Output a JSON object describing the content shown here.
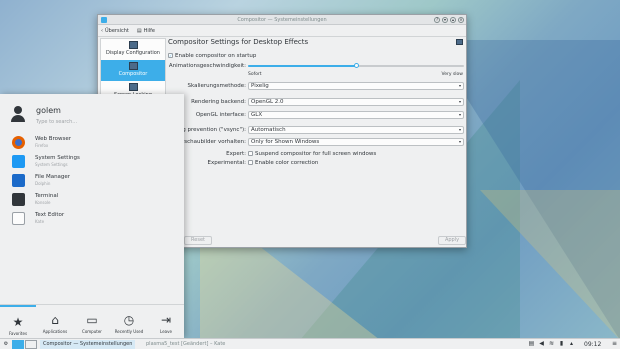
{
  "window": {
    "title": "Compositor — Systemeinstellungen",
    "back_label": "Übersicht",
    "help_label": "Hilfe",
    "sidebar": [
      {
        "label": "Display Configuration",
        "active": false
      },
      {
        "label": "Compositor",
        "active": true
      },
      {
        "label": "Screen Locking",
        "active": false
      }
    ],
    "heading": "Compositor Settings for Desktop Effects",
    "enable_label": "Enable compositor on startup",
    "animation_label": "Animationsgeschwindigkeit:",
    "animation_value": 0.5,
    "animation_min": "Sofort",
    "animation_max": "Very slow",
    "scaling_label": "Skalierungsmethode:",
    "scaling_value": "Pixelig",
    "backend_label": "Rendering backend:",
    "backend_value": "OpenGL 2.0",
    "interface_label": "OpenGL interface:",
    "interface_value": "GLX",
    "tearing_label": "Tearing prevention (\"vsync\"):",
    "tearing_value": "Automatisch",
    "thumb_label": "Vorschaubilder vorhalten:",
    "thumb_value": "Only for Shown Windows",
    "expert_label": "Expert:",
    "expert_option": "Suspend compositor for full screen windows",
    "experimental_label": "Experimental:",
    "experimental_option": "Enable color correction",
    "reset_label": "Reset",
    "apply_label": "Apply"
  },
  "launcher": {
    "user": "golem",
    "search_placeholder": "Type to search...",
    "apps": [
      {
        "name": "Web Browser",
        "desc": "Firefox",
        "color": "#e66000"
      },
      {
        "name": "System Settings",
        "desc": "System Settings",
        "color": "#1d99f3"
      },
      {
        "name": "File Manager",
        "desc": "Dolphin",
        "color": "#1b6ac9"
      },
      {
        "name": "Terminal",
        "desc": "Konsole",
        "color": "#31363b"
      },
      {
        "name": "Text Editor",
        "desc": "Kate",
        "color": "#fcfcfc"
      }
    ],
    "tabs": [
      {
        "label": "Favorites",
        "icon": "★"
      },
      {
        "label": "Applications",
        "icon": "⌂"
      },
      {
        "label": "Computer",
        "icon": "▭"
      },
      {
        "label": "Recently Used",
        "icon": "◷"
      },
      {
        "label": "Leave",
        "icon": "⇥"
      }
    ]
  },
  "taskbar": {
    "task1": "Compositor — Systemeinstellungen",
    "task2": "plasma5_test [Geändert] – Kate",
    "clock": "09:12"
  },
  "colors": {
    "accent": "#3daee9"
  }
}
